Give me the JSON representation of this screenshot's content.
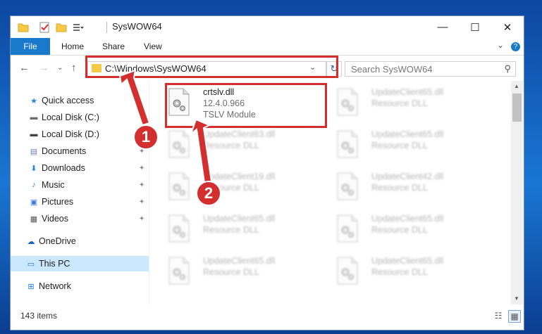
{
  "window": {
    "title": "SysWOW64",
    "minimize_glyph": "—",
    "maximize_glyph": "☐",
    "close_glyph": "✕"
  },
  "ribbon": {
    "tabs": [
      "File",
      "Home",
      "Share",
      "View"
    ],
    "expand_glyph": "⌄",
    "help_glyph": "?"
  },
  "address_bar": {
    "path": "C:\\Windows\\SysWOW64",
    "dropdown_glyph": "⌄",
    "refresh_glyph": "↻",
    "back_glyph": "←",
    "forward_glyph": "→",
    "recent_glyph": "⌄",
    "up_glyph": "↑"
  },
  "search": {
    "placeholder": "Search SysWOW64",
    "icon_glyph": "⚲"
  },
  "nav": [
    {
      "label": "Quick access",
      "icon": "star-icon",
      "glyph": "★",
      "color": "#1e88e5",
      "pinned": false
    },
    {
      "label": "Local Disk (C:)",
      "icon": "drive-icon",
      "glyph": "▬",
      "color": "#6d6d6d",
      "pinned": true
    },
    {
      "label": "Local Disk (D:)",
      "icon": "drive-icon",
      "glyph": "▬",
      "color": "#444444",
      "pinned": false
    },
    {
      "label": "Documents",
      "icon": "documents-icon",
      "glyph": "▤",
      "color": "#6b7fa8",
      "pinned": true
    },
    {
      "label": "Downloads",
      "icon": "download-icon",
      "glyph": "⬇",
      "color": "#1e88e5",
      "pinned": true
    },
    {
      "label": "Music",
      "icon": "music-icon",
      "glyph": "♪",
      "color": "#1e88e5",
      "pinned": true
    },
    {
      "label": "Pictures",
      "icon": "pictures-icon",
      "glyph": "▣",
      "color": "#3a7bd5",
      "pinned": true
    },
    {
      "label": "Videos",
      "icon": "videos-icon",
      "glyph": "▦",
      "color": "#555555",
      "pinned": true
    },
    {
      "label": "OneDrive",
      "icon": "cloud-icon",
      "glyph": "☁",
      "color": "#1565c0",
      "pinned": false
    },
    {
      "label": "This PC",
      "icon": "computer-icon",
      "glyph": "▭",
      "color": "#1976d2",
      "pinned": false
    },
    {
      "label": "Network",
      "icon": "network-icon",
      "glyph": "⊞",
      "color": "#1976d2",
      "pinned": false
    }
  ],
  "pin_glyph": "📌",
  "files": [
    {
      "name": "crtslv.dll",
      "version": "12.4.0.966",
      "description": "TSLV Module",
      "highlighted": true
    },
    {
      "name": "UpdateClient65.dll",
      "description": "Resource DLL"
    },
    {
      "name": "UpdateClient63.dll",
      "description": "Resource DLL"
    },
    {
      "name": "UpdateClient65.dll",
      "description": "Resource DLL"
    },
    {
      "name": "UpdateClient19.dll",
      "description": "Resource DLL"
    },
    {
      "name": "UpdateClient42.dll",
      "description": "Resource DLL"
    },
    {
      "name": "UpdateClient65.dll",
      "description": "Resource DLL"
    },
    {
      "name": "UpdateClient65.dll",
      "description": "Resource DLL"
    },
    {
      "name": "UpdateClient65.dll",
      "description": "Resource DLL"
    },
    {
      "name": "UpdateClient65.dll",
      "description": "Resource DLL"
    }
  ],
  "status": {
    "item_count": "143 items"
  },
  "annotations": {
    "step1": "1",
    "step2": "2",
    "highlight_color": "#d32f2f"
  }
}
